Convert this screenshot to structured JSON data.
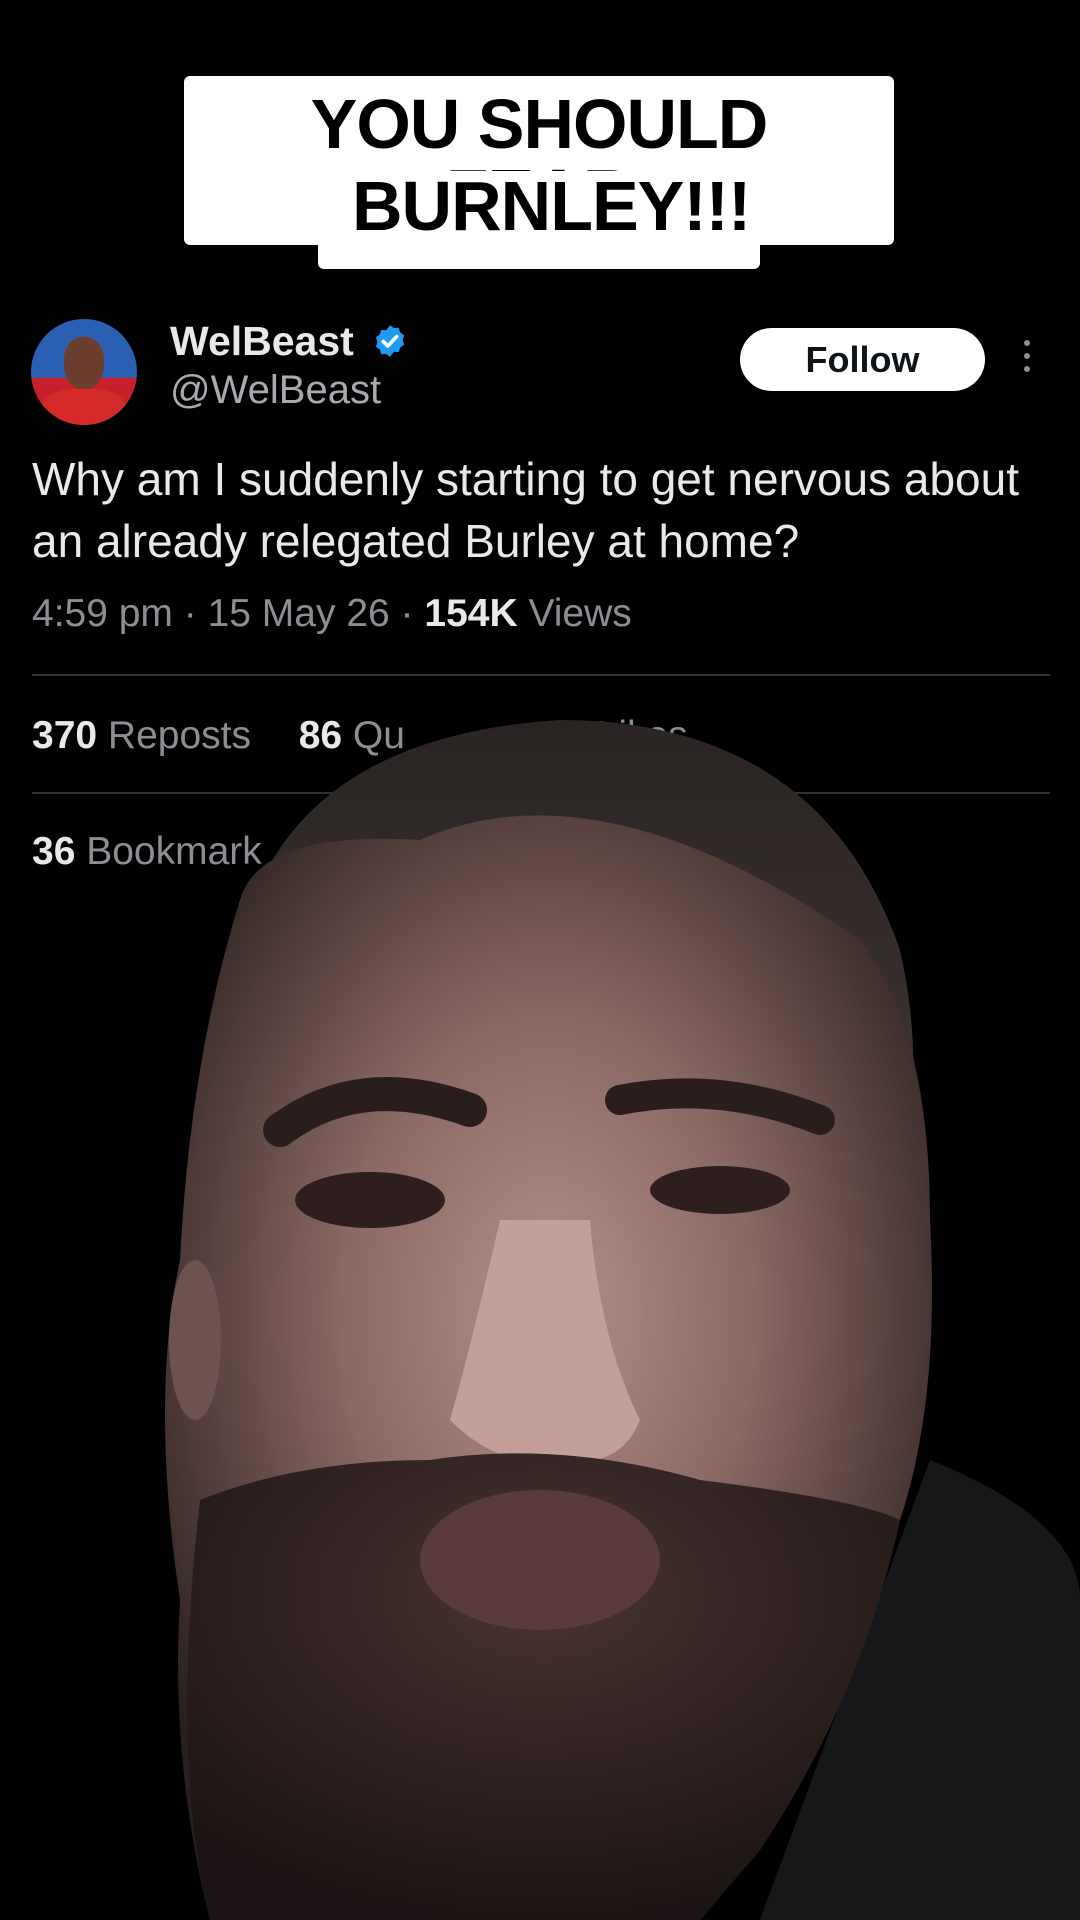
{
  "caption": {
    "line1": "YOU SHOULD FEAR",
    "line2": "BURNLEY!!!"
  },
  "tweet": {
    "display_name": "WelBeast",
    "handle": "@WelBeast",
    "follow_label": "Follow",
    "text": "Why am I suddenly starting to get nervous about an already relegated Burley at home?",
    "time": "4:59 pm",
    "date": "15 May 26",
    "views_count": "154K",
    "views_label": "Views",
    "reposts_count": "370",
    "reposts_label": "Reposts",
    "quotes_count": "86",
    "quotes_label_visible": "Qu",
    "likes_label": "Likes",
    "bookmarks_count": "36",
    "bookmarks_label_visible": "Bookmark"
  },
  "colors": {
    "background": "#000000",
    "caption_bg": "#ffffff",
    "verified": "#1d9bf0",
    "secondary_text": "#8b8f94"
  },
  "icons": [
    "verified-badge-icon",
    "more-options-icon"
  ]
}
